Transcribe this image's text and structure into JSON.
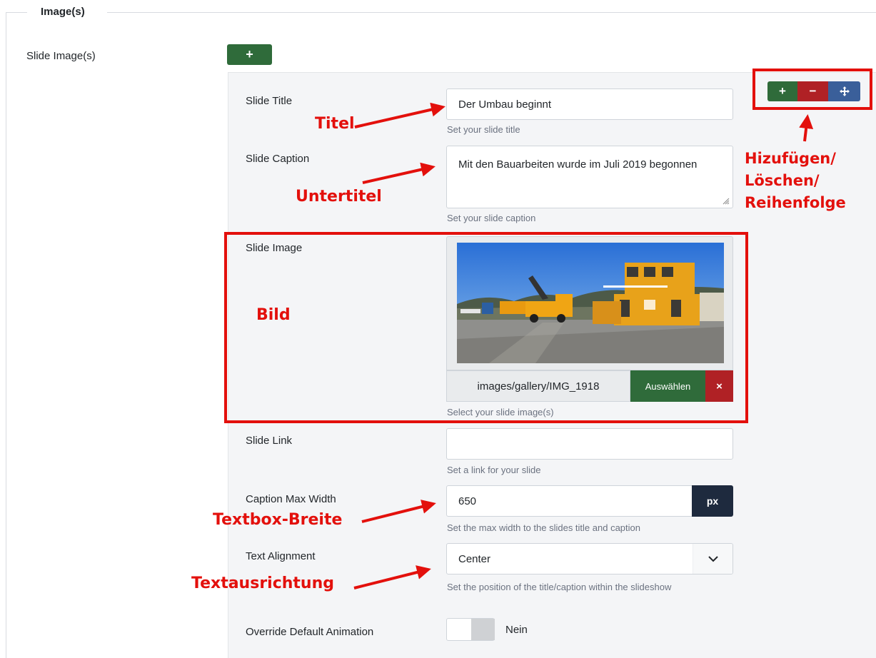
{
  "fieldset": {
    "legend": "Image(s)"
  },
  "slide_images": {
    "label": "Slide Image(s)",
    "add_label": "+"
  },
  "item_controls": {
    "add": "+",
    "remove": "−",
    "move_icon": "move-icon"
  },
  "fields": {
    "title": {
      "label": "Slide Title",
      "value": "Der Umbau beginnt",
      "help": "Set your slide title"
    },
    "caption": {
      "label": "Slide Caption",
      "value": "Mit den Bauarbeiten wurde im Juli 2019 begonnen",
      "help": "Set your slide caption"
    },
    "image": {
      "label": "Slide Image",
      "path": "images/gallery/IMG_1918",
      "select_label": "Auswählen",
      "clear_label": "×",
      "help": "Select your slide image(s)"
    },
    "link": {
      "label": "Slide Link",
      "value": "",
      "help": "Set a link for your slide"
    },
    "max_width": {
      "label": "Caption Max Width",
      "value": "650",
      "unit": "px",
      "help": "Set the max width to the slides title and caption"
    },
    "alignment": {
      "label": "Text Alignment",
      "value": "Center",
      "help": "Set the position of the title/caption within the slideshow"
    },
    "animation": {
      "label": "Override Default Animation",
      "value": "Nein"
    }
  },
  "annotations": {
    "titel": "Titel",
    "untertitel": "Untertitel",
    "bild": "Bild",
    "textbox_breite": "Textbox-Breite",
    "textausrichtung": "Textausrichtung",
    "controls_line1": "Hizufügen/",
    "controls_line2": "Löschen/",
    "controls_line3": "Reihenfolge"
  },
  "colors": {
    "annotation_red": "#e3100c",
    "success": "#2f6b3a",
    "danger": "#b02125",
    "navy": "#1e2a3e",
    "move_blue": "#3a5f9a"
  }
}
